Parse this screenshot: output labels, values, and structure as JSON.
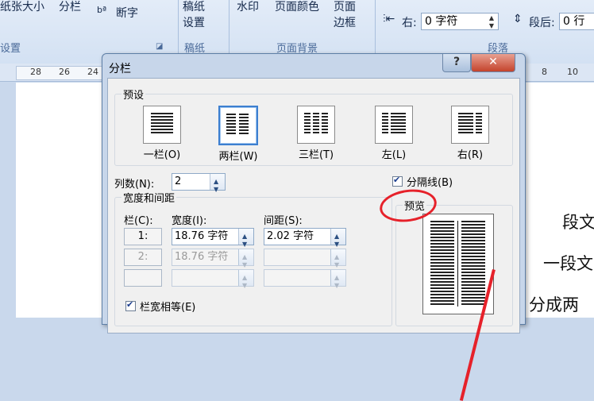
{
  "ribbon": {
    "items": [
      "纸张大小",
      "分栏",
      "断字",
      "稿纸",
      "设置",
      "水印",
      "页面颜色",
      "页面",
      "边框"
    ],
    "hyphen_prefix": "bª",
    "group_labels": [
      "设置",
      "稿纸",
      "页面背景",
      "段落"
    ],
    "indent_right_label": "右:",
    "indent_right_value": "0 字符",
    "spacing_after_label": "段后:",
    "spacing_after_value": "0 行"
  },
  "ruler": {
    "numbers": [
      "28",
      "26",
      "24",
      "8",
      "10"
    ]
  },
  "document": {
    "lines": [
      "段文",
      "一段文",
      "分成两"
    ]
  },
  "dialog": {
    "title": "分栏",
    "help_label": "?",
    "close_label": "✕",
    "presets_legend": "预设",
    "presets": [
      {
        "label": "一栏(O)",
        "cols": 1,
        "selected": false
      },
      {
        "label": "两栏(W)",
        "cols": 2,
        "selected": true
      },
      {
        "label": "三栏(T)",
        "cols": 3,
        "selected": false
      },
      {
        "label": "左(L)",
        "cols": "left",
        "selected": false
      },
      {
        "label": "右(R)",
        "cols": "right",
        "selected": false
      }
    ],
    "num_columns_label": "列数(N):",
    "num_columns_value": "2",
    "separator_label": "分隔线(B)",
    "separator_checked": true,
    "width_spacing_legend": "宽度和间距",
    "col_header": "栏(C):",
    "width_header": "宽度(I):",
    "spacing_header": "间距(S):",
    "rows": [
      {
        "col": "1:",
        "width": "18.76 字符",
        "spacing": "2.02 字符",
        "enabled": true
      },
      {
        "col": "2:",
        "width": "18.76 字符",
        "spacing": "",
        "enabled": false
      },
      {
        "col": "",
        "width": "",
        "spacing": "",
        "enabled": false
      }
    ],
    "equal_width_label": "栏宽相等(E)",
    "equal_width_checked": true,
    "preview_legend": "预览"
  },
  "colors": {
    "annotation": "#e6212a",
    "selection": "#3c7fd0"
  }
}
